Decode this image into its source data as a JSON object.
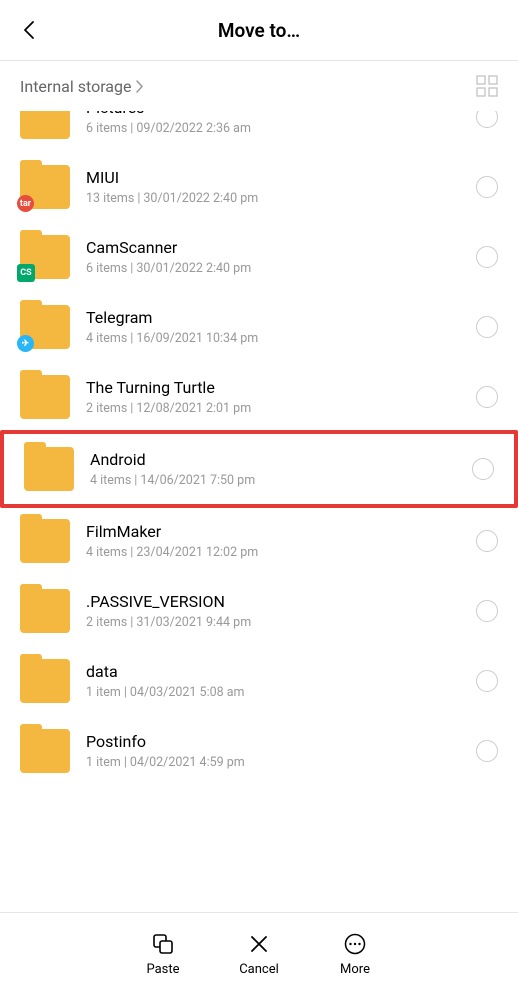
{
  "header": {
    "title": "Move to…"
  },
  "breadcrumb": {
    "path": "Internal storage"
  },
  "folders": [
    {
      "name": "Pictures",
      "items": "6 items",
      "date": "09/02/2022 2:36 am",
      "overlay": null,
      "clipped": true,
      "highlighted": false
    },
    {
      "name": "MIUI",
      "items": "13 items",
      "date": "30/01/2022 2:40 pm",
      "overlay": "red",
      "overlayText": "tar",
      "clipped": false,
      "highlighted": false
    },
    {
      "name": "CamScanner",
      "items": "6 items",
      "date": "30/01/2022 2:40 pm",
      "overlay": "green",
      "overlayText": "CS",
      "clipped": false,
      "highlighted": false
    },
    {
      "name": "Telegram",
      "items": "4 items",
      "date": "16/09/2021 10:34 pm",
      "overlay": "blue",
      "overlayText": "✈",
      "clipped": false,
      "highlighted": false
    },
    {
      "name": "The Turning Turtle",
      "items": "2 items",
      "date": "12/08/2021 2:01 pm",
      "overlay": null,
      "clipped": false,
      "highlighted": false
    },
    {
      "name": "Android",
      "items": "4 items",
      "date": "14/06/2021 7:50 pm",
      "overlay": null,
      "clipped": false,
      "highlighted": true
    },
    {
      "name": "FilmMaker",
      "items": "4 items",
      "date": "23/04/2021 12:02 pm",
      "overlay": null,
      "clipped": false,
      "highlighted": false
    },
    {
      "name": ".PASSIVE_VERSION",
      "items": "2 items",
      "date": "31/03/2021 9:44 pm",
      "overlay": null,
      "clipped": false,
      "highlighted": false
    },
    {
      "name": "data",
      "items": "1 item",
      "date": "04/03/2021 5:08 am",
      "overlay": null,
      "clipped": false,
      "highlighted": false
    },
    {
      "name": "Postinfo",
      "items": "1 item",
      "date": "04/02/2021 4:59 pm",
      "overlay": null,
      "clipped": false,
      "highlighted": false
    }
  ],
  "actions": {
    "paste": "Paste",
    "cancel": "Cancel",
    "more": "More"
  }
}
